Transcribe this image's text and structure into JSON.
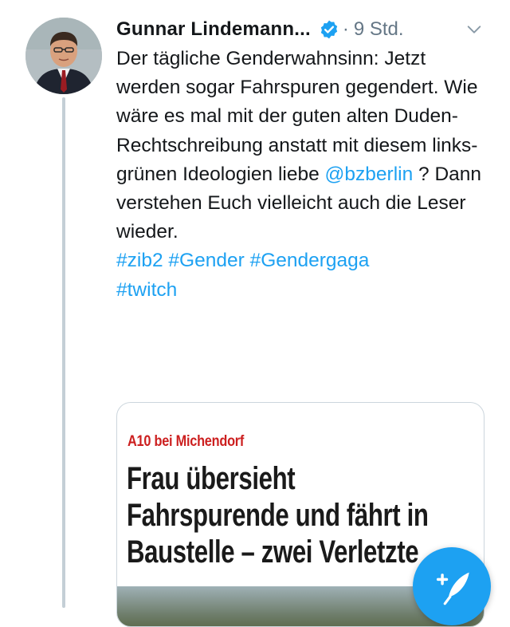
{
  "tweet": {
    "author_name": "Gunnar Lindemann...",
    "separator": "·",
    "timestamp": "9 Std.",
    "text_before_mention": "Der tägliche Genderwahnsinn: Jetzt werden sogar Fahrspuren gegendert. Wie wäre es mal mit der guten alten Duden-Rechtschreibung anstatt mit diesem links-grünen Ideologien liebe ",
    "mention": "@bzberlin",
    "text_after_mention": " ? Dann verstehen Euch vielleicht auch die Leser wieder.",
    "hashtags": [
      "#zib2",
      "#Gender",
      "#Gendergaga",
      "#twitch"
    ]
  },
  "card": {
    "kicker": "A10 bei Michendorf",
    "headline_lines": [
      "Frau übersieht",
      "Fahrspurende und fährt in",
      "Baustelle – zwei Verletzte"
    ]
  },
  "colors": {
    "link": "#1da1f2",
    "text": "#14171a",
    "muted": "#657786",
    "kicker": "#cc1f1f",
    "thread_line": "#c4cfd6"
  },
  "icons": [
    "verified-icon",
    "chevron-down-icon",
    "compose-tweet-icon"
  ]
}
